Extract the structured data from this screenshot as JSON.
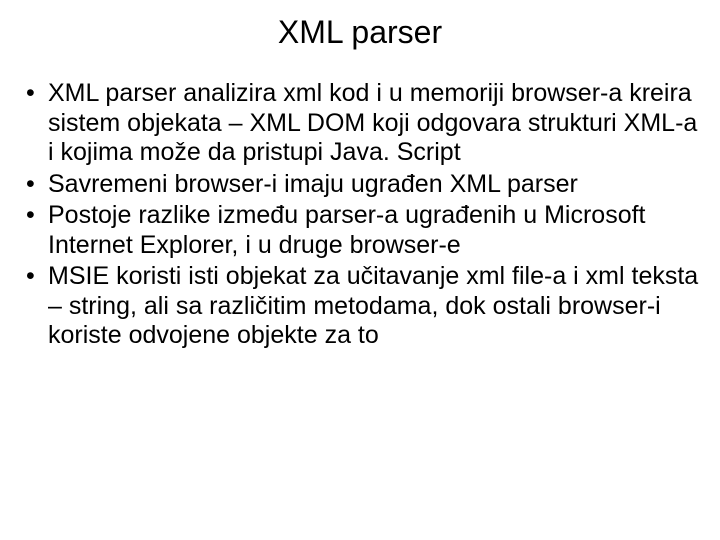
{
  "title": "XML parser",
  "bullets": [
    "XML parser analizira xml kod i u memoriji browser-a kreira sistem objekata – XML DOM koji odgovara strukturi XML-a i kojima može da pristupi Java. Script",
    "Savremeni browser-i imaju ugrađen XML parser",
    "Postoje razlike između parser-a ugrađenih u Microsoft Internet Explorer, i u druge browser-e",
    "MSIE koristi isti objekat za učitavanje xml file-a i xml teksta – string, ali sa različitim metodama, dok ostali browser-i koriste odvojene objekte za to"
  ]
}
